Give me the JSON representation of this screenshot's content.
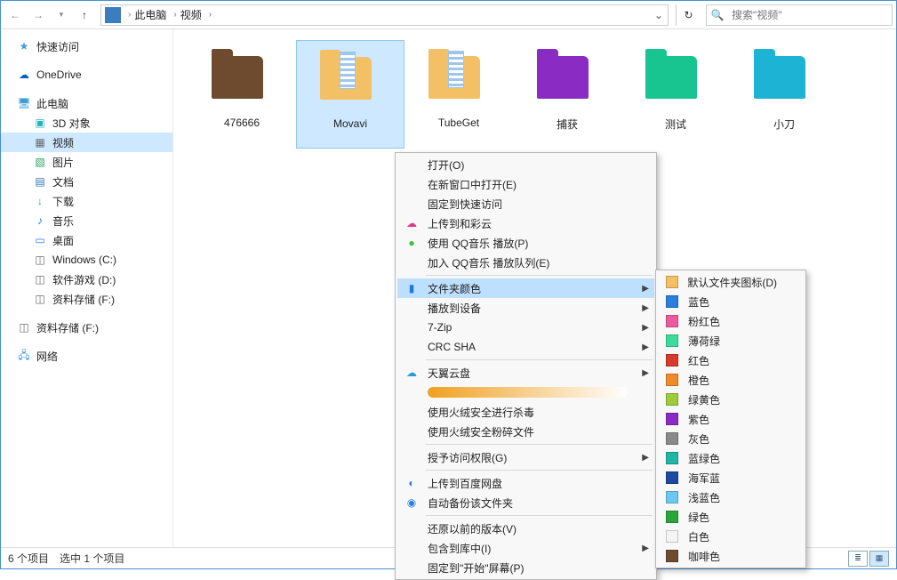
{
  "nav": {
    "breadcrumb": [
      "此电脑",
      "视频"
    ],
    "search_placeholder": "搜索\"视频\""
  },
  "sidebar": {
    "quick": "快速访问",
    "onedrive": "OneDrive",
    "thispc": "此电脑",
    "items": [
      {
        "label": "3D 对象",
        "cls": "i-3d",
        "glyph": "▣"
      },
      {
        "label": "视频",
        "cls": "i-vid",
        "glyph": "▦",
        "selected": true
      },
      {
        "label": "图片",
        "cls": "i-img",
        "glyph": "▧"
      },
      {
        "label": "文档",
        "cls": "i-doc",
        "glyph": "▤"
      },
      {
        "label": "下载",
        "cls": "i-dl",
        "glyph": "↓"
      },
      {
        "label": "音乐",
        "cls": "i-mus",
        "glyph": "♪"
      },
      {
        "label": "桌面",
        "cls": "i-desk",
        "glyph": "▭"
      },
      {
        "label": "Windows (C:)",
        "cls": "i-drv",
        "glyph": "◫"
      },
      {
        "label": "软件游戏 (D:)",
        "cls": "i-drv",
        "glyph": "◫"
      },
      {
        "label": "资料存储 (F:)",
        "cls": "i-drv",
        "glyph": "◫"
      }
    ],
    "extra_drive": "资料存储 (F:)",
    "network": "网络"
  },
  "tiles": [
    {
      "label": "476666",
      "color": "f-brown",
      "selected": false,
      "paper": false
    },
    {
      "label": "Movavi",
      "color": "f-manila",
      "selected": true,
      "paper": true
    },
    {
      "label": "TubeGet",
      "color": "f-manila",
      "selected": false,
      "paper": true
    },
    {
      "label": "捕获",
      "color": "f-purple",
      "selected": false,
      "paper": false
    },
    {
      "label": "测试",
      "color": "f-green",
      "selected": false,
      "paper": false
    },
    {
      "label": "小刀",
      "color": "f-cyan",
      "selected": false,
      "paper": false
    }
  ],
  "status": {
    "count": "6 个项目",
    "selected": "选中 1 个项目"
  },
  "ctx": [
    {
      "label": "打开(O)"
    },
    {
      "label": "在新窗口中打开(E)"
    },
    {
      "label": "固定到快速访问"
    },
    {
      "label": "上传到和彩云",
      "icon": "☁",
      "ic_color": "#e03a8c"
    },
    {
      "label": "使用 QQ音乐 播放(P)",
      "icon": "●",
      "ic_color": "#3bbf3b"
    },
    {
      "label": "加入 QQ音乐 播放队列(E)"
    },
    {
      "sep": true
    },
    {
      "label": "文件夹颜色",
      "icon": "▮",
      "ic_color": "#1f7bd6",
      "submenu": true,
      "hover": true
    },
    {
      "label": "播放到设备",
      "submenu": true
    },
    {
      "label": "7-Zip",
      "submenu": true
    },
    {
      "label": "CRC SHA",
      "submenu": true
    },
    {
      "sep": true
    },
    {
      "label": "天翼云盘",
      "icon": "☁",
      "ic_color": "#1f9de0",
      "submenu": true
    },
    {
      "blank": true
    },
    {
      "label": "使用火绒安全进行杀毒"
    },
    {
      "label": "使用火绒安全粉碎文件"
    },
    {
      "sep": true
    },
    {
      "label": "授予访问权限(G)",
      "submenu": true
    },
    {
      "sep": true
    },
    {
      "label": "上传到百度网盘",
      "icon": "◐",
      "ic_color": "#2a7de1"
    },
    {
      "label": "自动备份该文件夹",
      "icon": "◉",
      "ic_color": "#2a7de1"
    },
    {
      "sep": true
    },
    {
      "label": "还原以前的版本(V)"
    },
    {
      "label": "包含到库中(I)",
      "submenu": true
    },
    {
      "label": "固定到\"开始\"屏幕(P)"
    }
  ],
  "colors": [
    {
      "label": "默认文件夹图标(D)",
      "c": "#f3c065"
    },
    {
      "label": "蓝色",
      "c": "#2a7de1"
    },
    {
      "label": "粉红色",
      "c": "#ec5aa0"
    },
    {
      "label": "薄荷绿",
      "c": "#3bdc9a"
    },
    {
      "label": "红色",
      "c": "#d83a2b"
    },
    {
      "label": "橙色",
      "c": "#f08b2a"
    },
    {
      "label": "绿黄色",
      "c": "#9ecb3a"
    },
    {
      "label": "紫色",
      "c": "#8a2cc4"
    },
    {
      "label": "灰色",
      "c": "#8a8a8a"
    },
    {
      "label": "蓝绿色",
      "c": "#1fb7a3"
    },
    {
      "label": "海军蓝",
      "c": "#1b4aa0"
    },
    {
      "label": "浅蓝色",
      "c": "#6cc8f0"
    },
    {
      "label": "绿色",
      "c": "#2aa53a"
    },
    {
      "label": "白色",
      "c": "#f4f4f4"
    },
    {
      "label": "咖啡色",
      "c": "#6e4a2f"
    }
  ]
}
